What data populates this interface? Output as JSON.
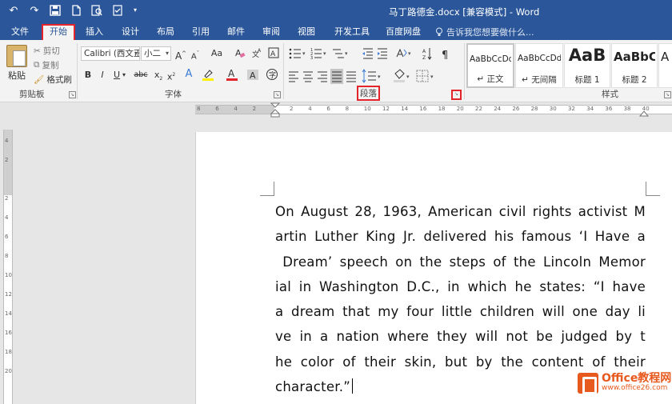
{
  "title_bar": {
    "title": "马丁路德金.docx [兼容模式] - Word"
  },
  "qat": {
    "undo_glyph": "↶",
    "redo_glyph": "↷",
    "save_glyph": "▣",
    "dropdown_glyph": "▾"
  },
  "tabs": {
    "items": [
      {
        "label": "文件"
      },
      {
        "label": "开始"
      },
      {
        "label": "插入"
      },
      {
        "label": "设计"
      },
      {
        "label": "布局"
      },
      {
        "label": "引用"
      },
      {
        "label": "邮件"
      },
      {
        "label": "审阅"
      },
      {
        "label": "视图"
      },
      {
        "label": "开发工具"
      },
      {
        "label": "百度网盘"
      }
    ],
    "tell_me": "告诉我您想要做什么...",
    "active": "开始"
  },
  "clipboard": {
    "paste": "粘贴",
    "cut": "剪切",
    "copy": "复制",
    "format_painter": "格式刷",
    "group_label": "剪贴板"
  },
  "font": {
    "font_name": "Calibri (西文正",
    "font_size": "小二",
    "grow": "A",
    "shrink": "A",
    "case": "Aa",
    "bold": "B",
    "italic": "I",
    "underline": "U",
    "strike": "abc",
    "subscript": "x",
    "superscript": "x",
    "group_label": "字体"
  },
  "paragraph": {
    "group_label": "段落"
  },
  "styles": {
    "items": [
      {
        "sample": "AaBbCcDd",
        "name": "↵ 正文"
      },
      {
        "sample": "AaBbCcDd",
        "name": "↵ 无间隔"
      },
      {
        "sample": "AaB",
        "name": "标题 1"
      },
      {
        "sample": "AaBbC",
        "name": "标题 2"
      },
      {
        "sample": "A",
        "name": ""
      }
    ],
    "group_label": "样式"
  },
  "ruler": {
    "h_numbers": [
      "8",
      "6",
      "4",
      "2",
      "",
      "2",
      "4",
      "6",
      "8",
      "10",
      "12",
      "14",
      "16",
      "18",
      "20",
      "22",
      "24",
      "26",
      "28",
      "30",
      "32",
      "34",
      "36",
      "38",
      "40"
    ],
    "v_numbers": [
      "4",
      "2",
      "",
      "2",
      "4",
      "6",
      "8",
      "10",
      "12",
      "14",
      "16",
      "18",
      "20"
    ]
  },
  "document": {
    "lines": [
      "On August 28, 1963, American civil rights activist M",
      "artin Luther King Jr. delivered his famous ‘I Have a",
      " Dream’ speech on the steps of the Lincoln Memor",
      "ial in Washington D.C., in which he states: “I have",
      "a dream that my four little children will one day li",
      "ve in a nation where they will not be judged by t",
      "he color of their skin, but by the content of their",
      "character.”"
    ]
  },
  "watermark": {
    "name": "Office教程网",
    "url": "www.office26.com"
  }
}
